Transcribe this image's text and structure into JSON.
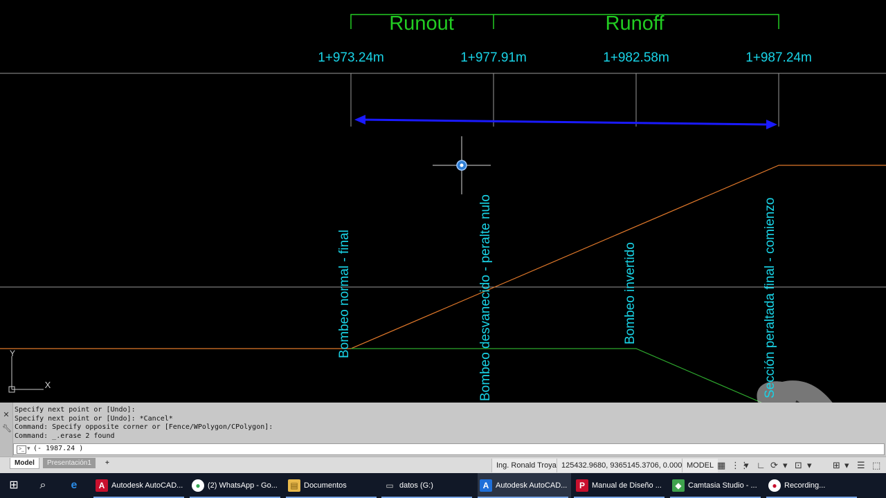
{
  "header_labels": {
    "runout": "Runout",
    "runoff": "Runoff"
  },
  "stations": [
    "1+973.24m",
    "1+977.91m",
    "1+982.58m",
    "1+987.24m"
  ],
  "vertical_labels": [
    "Bombeo normal - final",
    "Bombeo desvanecido - peralte nulo",
    "Bombeo invertido",
    "Sección peraltada final - comienzo"
  ],
  "ucs": {
    "y_label": "Y",
    "x_label": "X"
  },
  "colors": {
    "canvas_bg": "#000000",
    "header_green": "#22cc22",
    "station_cyan": "#19d3e6",
    "arrow_blue": "#1a1aff",
    "profile_orange": "#e0782a",
    "profile_green": "#2ea82e",
    "grid_gray": "#9a9a9a"
  },
  "command_line": {
    "history": [
      "Specify next point or [Undo]:",
      "Specify next point or [Undo]: *Cancel*",
      "Command: Specify opposite corner or [Fence/WPolygon/CPolygon]:",
      "Command: _.erase 2 found"
    ],
    "input_value": "(- 1987.24 )",
    "gutter_icons": [
      "close-icon",
      "wrench-icon"
    ]
  },
  "layout_tabs": {
    "model": "Model",
    "presentation": "Presentación1",
    "add": "+"
  },
  "status_bar": {
    "user": "Ing. Ronald Troya",
    "coordinates": "125432.9680, 9365145.3706, 0.0000",
    "space": "MODEL"
  },
  "taskbar": {
    "apps": [
      {
        "label": "Autodesk AutoCAD...",
        "icon": "autocad-icon",
        "color": "#c8102e",
        "glyph": "A"
      },
      {
        "label": "(2) WhatsApp - Go...",
        "icon": "chrome-icon",
        "color": "#fbbc05",
        "glyph": "●"
      },
      {
        "label": "Documentos",
        "icon": "folder-icon",
        "color": "#e8b84a",
        "glyph": "▤"
      },
      {
        "label": "datos (G:)",
        "icon": "drive-icon",
        "color": "#9aa",
        "glyph": "▭"
      },
      {
        "label": "Autodesk AutoCAD...",
        "icon": "autocad-icon",
        "color": "#1e6fd9",
        "glyph": "A"
      },
      {
        "label": "Manual de Diseño ...",
        "icon": "pdf-icon",
        "color": "#c8102e",
        "glyph": "P"
      },
      {
        "label": "Camtasia Studio - ...",
        "icon": "camtasia-icon",
        "color": "#3fa34d",
        "glyph": "◆"
      },
      {
        "label": "Recording...",
        "icon": "recording-icon",
        "color": "#c8102e",
        "glyph": "●"
      }
    ]
  }
}
